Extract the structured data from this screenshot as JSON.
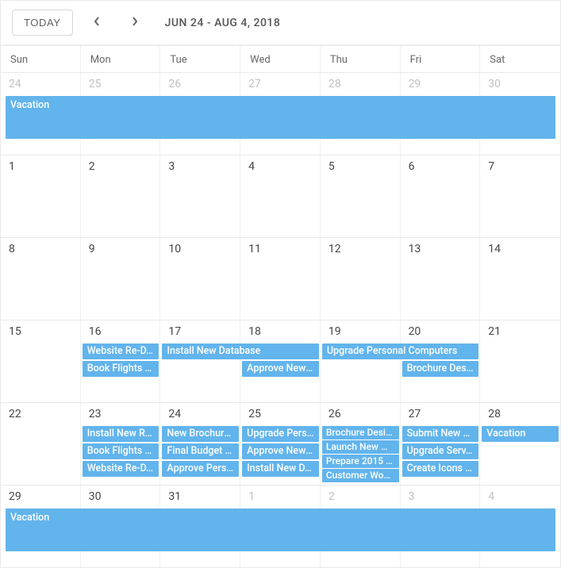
{
  "colors": {
    "event_bg": "#62b4ec",
    "muted": "#c0c0c0"
  },
  "toolbar": {
    "today_label": "TODAY",
    "range_label": "JUN 24 - AUG 4, 2018"
  },
  "day_headers": [
    "Sun",
    "Mon",
    "Tue",
    "Wed",
    "Thu",
    "Fri",
    "Sat"
  ],
  "weeks": [
    {
      "days": [
        {
          "n": "24",
          "other": true
        },
        {
          "n": "25",
          "other": true
        },
        {
          "n": "26",
          "other": true
        },
        {
          "n": "27",
          "other": true
        },
        {
          "n": "28",
          "other": true
        },
        {
          "n": "29",
          "other": true
        },
        {
          "n": "30",
          "other": true
        }
      ],
      "events": [
        {
          "title": "Vacation",
          "start": 0,
          "span": 7,
          "row": 0,
          "allday": true
        }
      ]
    },
    {
      "days": [
        {
          "n": "1"
        },
        {
          "n": "2"
        },
        {
          "n": "3"
        },
        {
          "n": "4"
        },
        {
          "n": "5"
        },
        {
          "n": "6"
        },
        {
          "n": "7"
        }
      ],
      "events": []
    },
    {
      "days": [
        {
          "n": "8"
        },
        {
          "n": "9"
        },
        {
          "n": "10"
        },
        {
          "n": "11"
        },
        {
          "n": "12"
        },
        {
          "n": "13"
        },
        {
          "n": "14"
        }
      ],
      "events": []
    },
    {
      "days": [
        {
          "n": "15"
        },
        {
          "n": "16"
        },
        {
          "n": "17"
        },
        {
          "n": "18"
        },
        {
          "n": "19"
        },
        {
          "n": "20"
        },
        {
          "n": "21"
        }
      ],
      "events": [
        {
          "title": "Website Re-D…",
          "start": 1,
          "span": 1,
          "row": 0
        },
        {
          "title": "Install New Database",
          "start": 2,
          "span": 2,
          "row": 0
        },
        {
          "title": "Upgrade Personal Computers",
          "start": 4,
          "span": 2,
          "row": 0
        },
        {
          "title": "Book Flights t…",
          "start": 1,
          "span": 1,
          "row": 1
        },
        {
          "title": "Approve New …",
          "start": 3,
          "span": 1,
          "row": 1
        },
        {
          "title": "Brochure Desi…",
          "start": 5,
          "span": 1,
          "row": 1
        }
      ]
    },
    {
      "days": [
        {
          "n": "22"
        },
        {
          "n": "23"
        },
        {
          "n": "24"
        },
        {
          "n": "25"
        },
        {
          "n": "26"
        },
        {
          "n": "27"
        },
        {
          "n": "28"
        }
      ],
      "events": [
        {
          "title": "Install New R…",
          "start": 1,
          "span": 1,
          "row": 0
        },
        {
          "title": "New Brochures",
          "start": 2,
          "span": 1,
          "row": 0
        },
        {
          "title": "Upgrade Pers…",
          "start": 3,
          "span": 1,
          "row": 0
        },
        {
          "title": "Brochure Desi…",
          "start": 4,
          "span": 1,
          "row": 0,
          "tight": true
        },
        {
          "title": "Submit New …",
          "start": 5,
          "span": 1,
          "row": 0
        },
        {
          "title": "Vacation",
          "start": 6,
          "span": 1,
          "row": 0
        },
        {
          "title": "Book Flights t…",
          "start": 1,
          "span": 1,
          "row": 1
        },
        {
          "title": "Final Budget …",
          "start": 2,
          "span": 1,
          "row": 1
        },
        {
          "title": "Approve New …",
          "start": 3,
          "span": 1,
          "row": 1
        },
        {
          "title": "Launch New …",
          "start": 4,
          "span": 1,
          "row": 1,
          "tight": true
        },
        {
          "title": "Upgrade Serv…",
          "start": 5,
          "span": 1,
          "row": 1
        },
        {
          "title": "Website Re-D…",
          "start": 1,
          "span": 1,
          "row": 2
        },
        {
          "title": "Approve Pers…",
          "start": 2,
          "span": 1,
          "row": 2
        },
        {
          "title": "Install New D…",
          "start": 3,
          "span": 1,
          "row": 2
        },
        {
          "title": "Prepare 2015 …",
          "start": 4,
          "span": 1,
          "row": 2,
          "tight": true
        },
        {
          "title": "Create Icons f…",
          "start": 5,
          "span": 1,
          "row": 2
        },
        {
          "title": "Customer Wo…",
          "start": 4,
          "span": 1,
          "row": 3,
          "tight": true
        }
      ]
    },
    {
      "days": [
        {
          "n": "29"
        },
        {
          "n": "30"
        },
        {
          "n": "31"
        },
        {
          "n": "1",
          "other": true
        },
        {
          "n": "2",
          "other": true
        },
        {
          "n": "3",
          "other": true
        },
        {
          "n": "4",
          "other": true
        }
      ],
      "events": [
        {
          "title": "Vacation",
          "start": 0,
          "span": 7,
          "row": 0,
          "allday": true
        }
      ]
    }
  ]
}
